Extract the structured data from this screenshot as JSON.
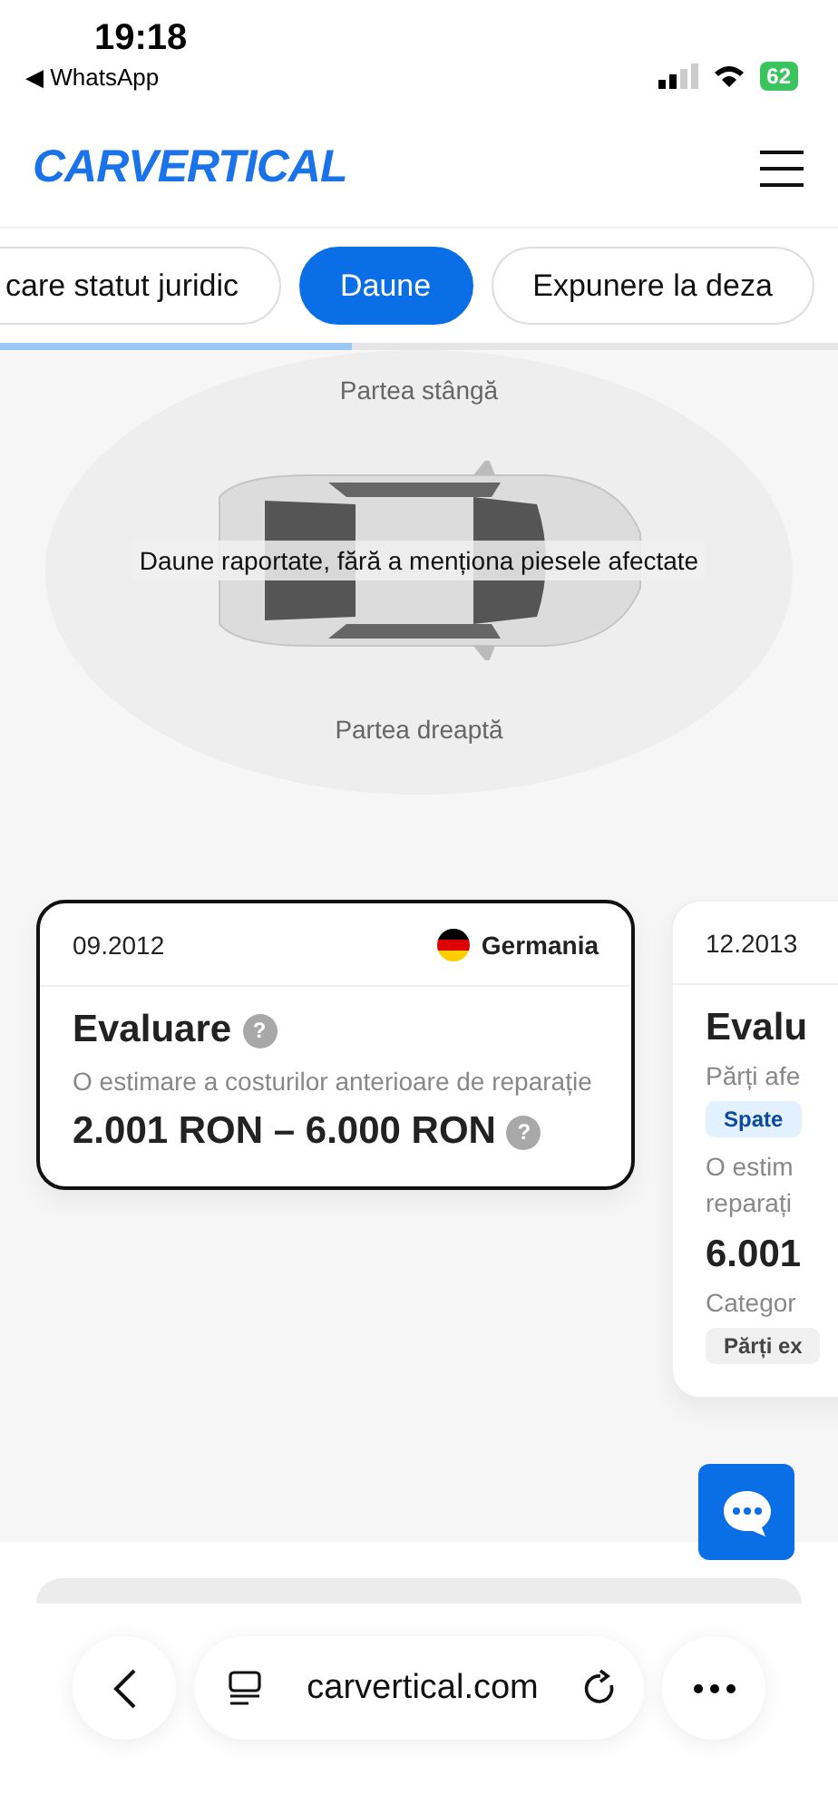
{
  "status_bar": {
    "time": "19:18",
    "back_app": "◀ WhatsApp",
    "battery": "62"
  },
  "header": {
    "logo": "CARVERTICAL"
  },
  "tabs": [
    {
      "label": "care statut juridic",
      "selected": false
    },
    {
      "label": "Daune",
      "selected": true
    },
    {
      "label": "Expunere la deza",
      "selected": false
    }
  ],
  "tab_progress": {
    "level": 0.42
  },
  "damage_diagram": {
    "top_label": "Partea stângă",
    "bottom_label": "Partea dreaptă",
    "overlay_text": "Daune raportate, fără a menționa piesele afectate"
  },
  "cards": [
    {
      "selected": true,
      "date": "09.2012",
      "country": "Germania",
      "title": "Evaluare",
      "title_help": "?",
      "description": "O estimare a costurilor anterioare de reparație",
      "amount": "2.001 RON – 6.000 RON",
      "amount_help": "?"
    },
    {
      "selected": false,
      "date": "12.2013",
      "title": "Evalu",
      "parts_label": "Părți afe",
      "parts_tag": "Spate",
      "description": "O estim",
      "description_2": "reparați",
      "amount": "6.001",
      "category_label": "Categor",
      "category_tag": "Părți ex"
    }
  ],
  "browser_bar": {
    "url": "carvertical.com"
  }
}
